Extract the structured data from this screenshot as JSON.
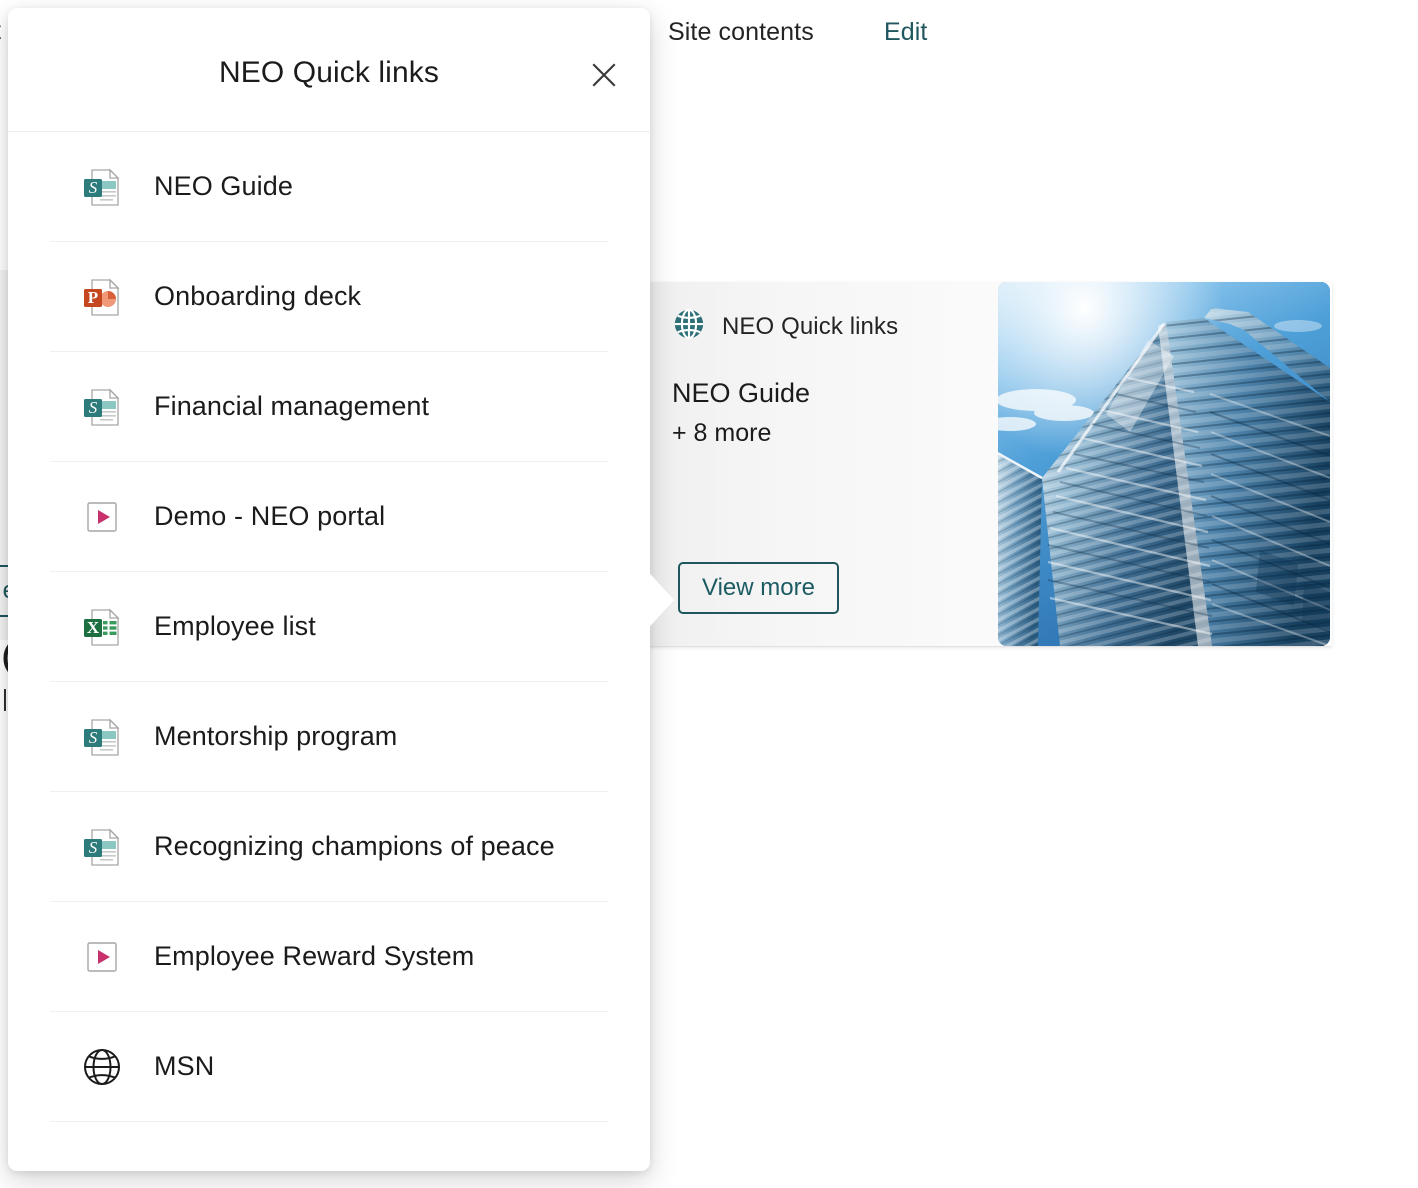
{
  "background": {
    "edge_text": "t",
    "site_contents_label": "Site contents",
    "edit_label": "Edit",
    "left_card_glyph_a": "(",
    "left_card_glyph_b": "|",
    "left_button_label": "e"
  },
  "card": {
    "source_label": "NEO Quick links",
    "first_link": "NEO Guide",
    "more_count_label": "+ 8 more",
    "view_more_label": "View more",
    "photo_alt": "glass skyscraper against blue sky"
  },
  "flyout": {
    "title": "NEO Quick links",
    "close_label": "Close",
    "items": [
      {
        "label": "NEO Guide",
        "icon": "sharepoint-page-icon"
      },
      {
        "label": "Onboarding deck",
        "icon": "powerpoint-file-icon"
      },
      {
        "label": "Financial management",
        "icon": "sharepoint-page-icon"
      },
      {
        "label": "Demo - NEO portal",
        "icon": "video-play-icon"
      },
      {
        "label": "Employee list",
        "icon": "excel-file-icon"
      },
      {
        "label": "Mentorship program",
        "icon": "sharepoint-page-icon"
      },
      {
        "label": "Recognizing champions of peace",
        "icon": "sharepoint-page-icon"
      },
      {
        "label": "Employee Reward System",
        "icon": "video-play-icon"
      },
      {
        "label": "MSN",
        "icon": "globe-icon"
      }
    ]
  },
  "colors": {
    "accent_teal": "#20575e",
    "sharepoint_teal": "#2d7b7b",
    "powerpoint_orange": "#c4471f",
    "excel_green": "#1d6f42",
    "video_pink": "#c8316b",
    "text_primary": "#1b1b1b",
    "divider": "#f0f0f0"
  }
}
